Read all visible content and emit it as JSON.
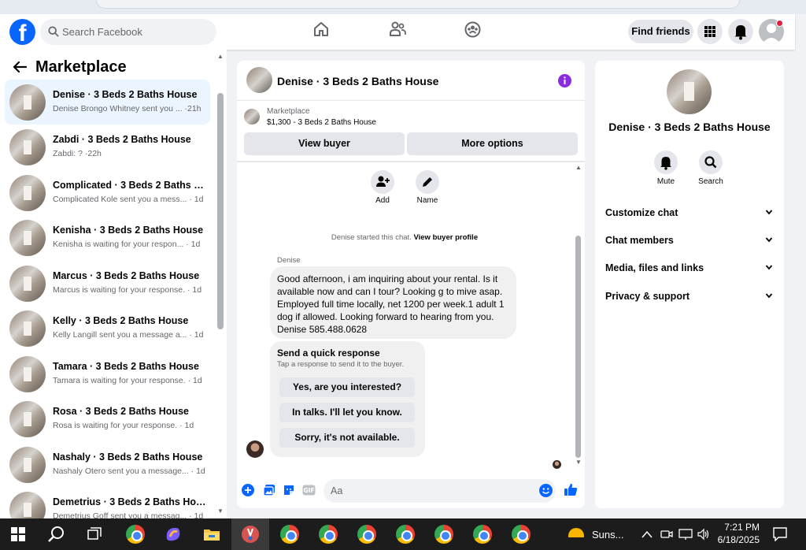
{
  "header": {
    "logo_text": "f",
    "search_placeholder": "Search Facebook",
    "find_friends": "Find friends"
  },
  "sidebar": {
    "title": "Marketplace",
    "conversations": [
      {
        "title": "Denise · 3 Beds 2 Baths House",
        "subtitle": "Denise Brongo Whitney sent you ... ·21h",
        "selected": true
      },
      {
        "title": "Zabdi · 3 Beds 2 Baths House",
        "subtitle": "Zabdi: ? ·22h"
      },
      {
        "title": "Complicated · 3 Beds 2 Baths H...",
        "subtitle": "Complicated Kole sent you a mess... · 1d"
      },
      {
        "title": "Kenisha · 3 Beds 2 Baths House",
        "subtitle": "Kenisha is waiting for your respon... · 1d"
      },
      {
        "title": "Marcus · 3 Beds 2 Baths House",
        "subtitle": "Marcus is waiting for your response. · 1d"
      },
      {
        "title": "Kelly · 3 Beds 2 Baths House",
        "subtitle": "Kelly Langill sent you a message a... · 1d"
      },
      {
        "title": "Tamara · 3 Beds 2 Baths House",
        "subtitle": "Tamara is waiting for your response. · 1d"
      },
      {
        "title": "Rosa · 3 Beds 2 Baths House",
        "subtitle": "Rosa is waiting for your response. · 1d"
      },
      {
        "title": "Nashaly · 3 Beds 2 Baths House",
        "subtitle": "Nashaly Otero sent you a message... · 1d"
      },
      {
        "title": "Demetrius · 3 Beds 2 Baths House",
        "subtitle": "Demetrius Goff sent you a messag... · 1d"
      }
    ]
  },
  "chat": {
    "title": "Denise · 3 Beds 2 Baths House",
    "listing_source": "Marketplace",
    "listing_price": "$1,300 - 3 Beds 2 Baths House",
    "view_buyer": "View buyer",
    "more_options": "More options",
    "add_label": "Add",
    "name_label": "Name",
    "started_text": "Denise started this chat.",
    "view_profile": "View buyer profile",
    "sender": "Denise",
    "message": "Good afternoon,  i am inquiring about your rental.  Is it available now and can I tour? Looking g to mive asap. Employed full time locally,  net 1200 per week.1 adult 1 dog if allowed. Looking forward to hearing from you. Denise 585.488.0628",
    "quick_title": "Send a quick response",
    "quick_sub": "Tap a response to send it to the buyer.",
    "quick_replies": [
      "Yes, are you interested?",
      "In talks. I'll let you know.",
      "Sorry, it's not available."
    ],
    "input_placeholder": "Aa"
  },
  "details": {
    "title": "Denise · 3 Beds 2 Baths House",
    "mute": "Mute",
    "search": "Search",
    "rows": [
      "Customize chat",
      "Chat members",
      "Media, files and links",
      "Privacy & support"
    ]
  },
  "taskbar": {
    "weather": "Suns...",
    "time": "7:21 PM",
    "date": "6/18/2025"
  },
  "colors": {
    "brand": "#0866ff",
    "accent_purple": "#8a2be2",
    "selected_bg": "#ebf5ff"
  }
}
